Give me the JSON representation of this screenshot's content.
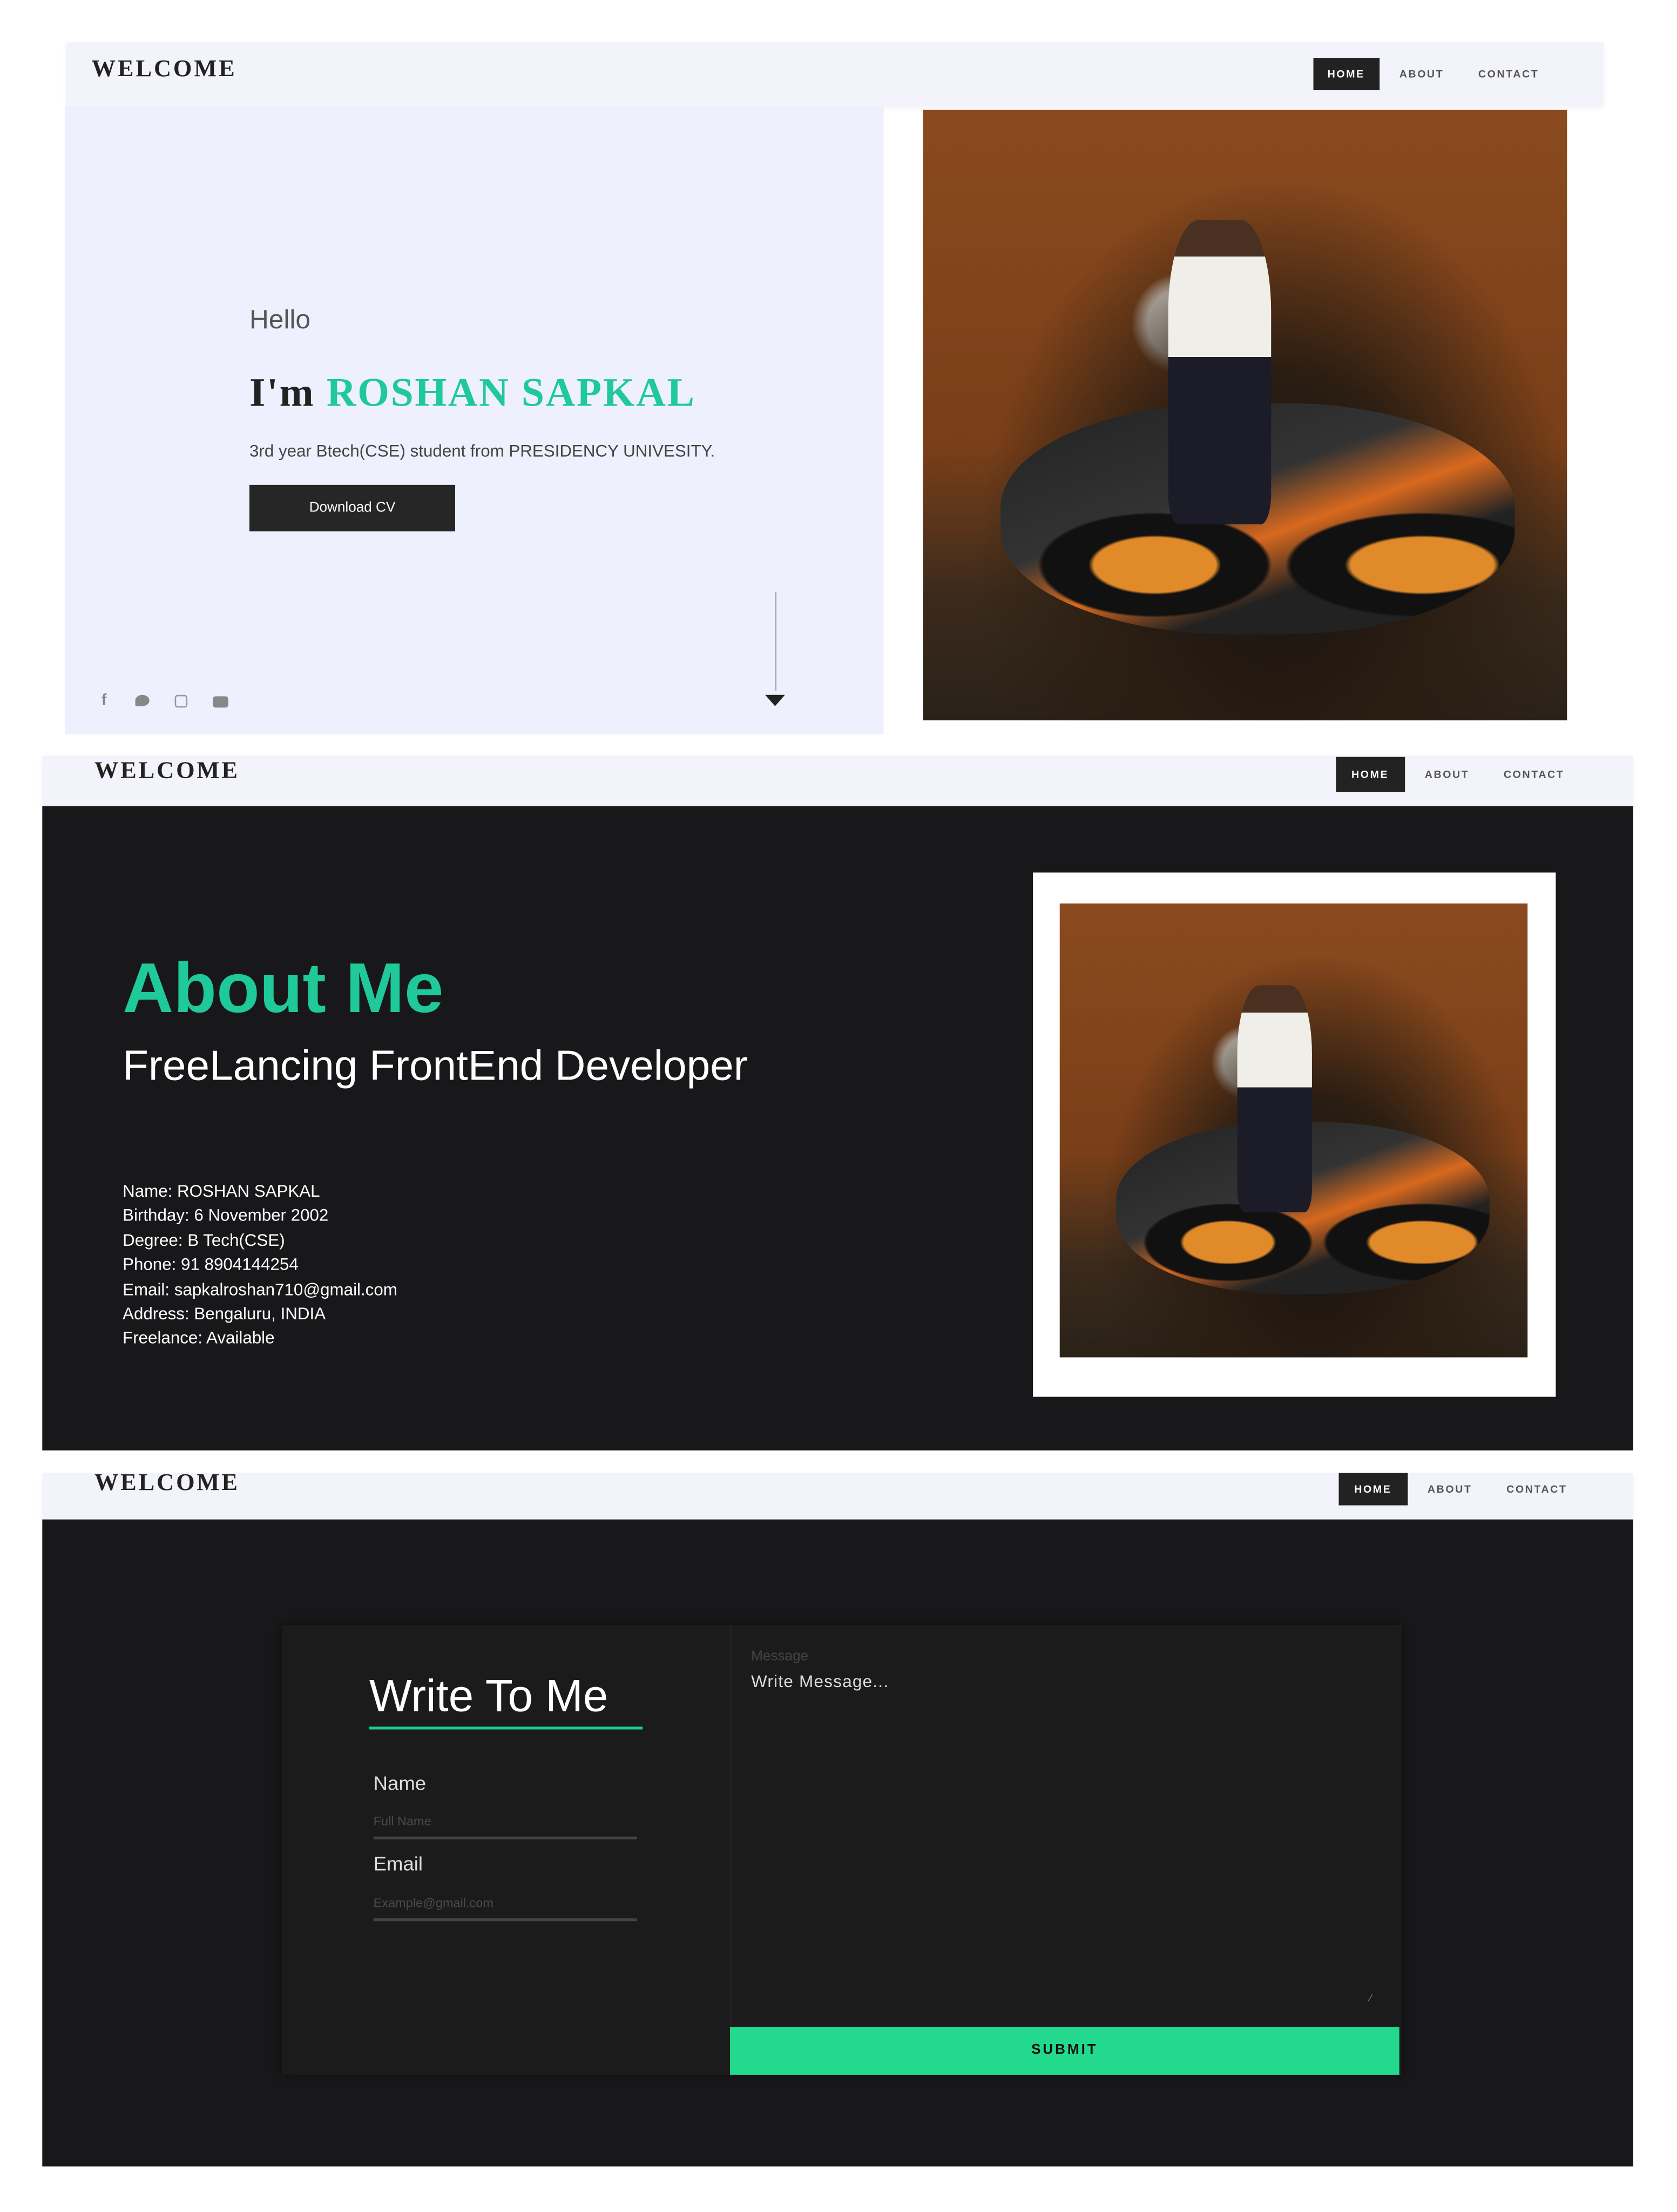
{
  "nav": {
    "brand": "WELCOME",
    "links": [
      {
        "label": "HOME",
        "active": true
      },
      {
        "label": "ABOUT"
      },
      {
        "label": "CONTACT"
      }
    ]
  },
  "home": {
    "greeting": "Hello",
    "intro_prefix": "I'm",
    "name": "ROSHAN SAPKAL",
    "subtitle": "3rd year Btech(CSE) student from PRESIDENCY UNIVESITY.",
    "download_label": "Download CV",
    "social_icons": [
      "facebook-icon",
      "twitter-icon",
      "instagram-icon",
      "youtube-icon"
    ]
  },
  "about": {
    "title": "About Me",
    "subtitle": "FreeLancing FrontEnd Developer",
    "details": [
      "Name: ROSHAN SAPKAL",
      "Birthday: 6 November 2002",
      "Degree: B Tech(CSE)",
      "Phone: 91 8904144254",
      "Email: sapkalroshan710@gmail.com",
      "Address: Bengaluru, INDIA",
      "Freelance: Available"
    ]
  },
  "contact": {
    "title": "Write To Me",
    "name_label": "Name",
    "name_placeholder": "Full Name",
    "email_label": "Email",
    "email_placeholder": "Example@gmail.com",
    "message_label": "Message",
    "message_placeholder": "Write Message...",
    "submit_label": "SUBMIT"
  },
  "colors": {
    "accent": "#1fc99a",
    "submit": "#22d98e",
    "dark": "#18181a",
    "light": "#eef0fd"
  }
}
